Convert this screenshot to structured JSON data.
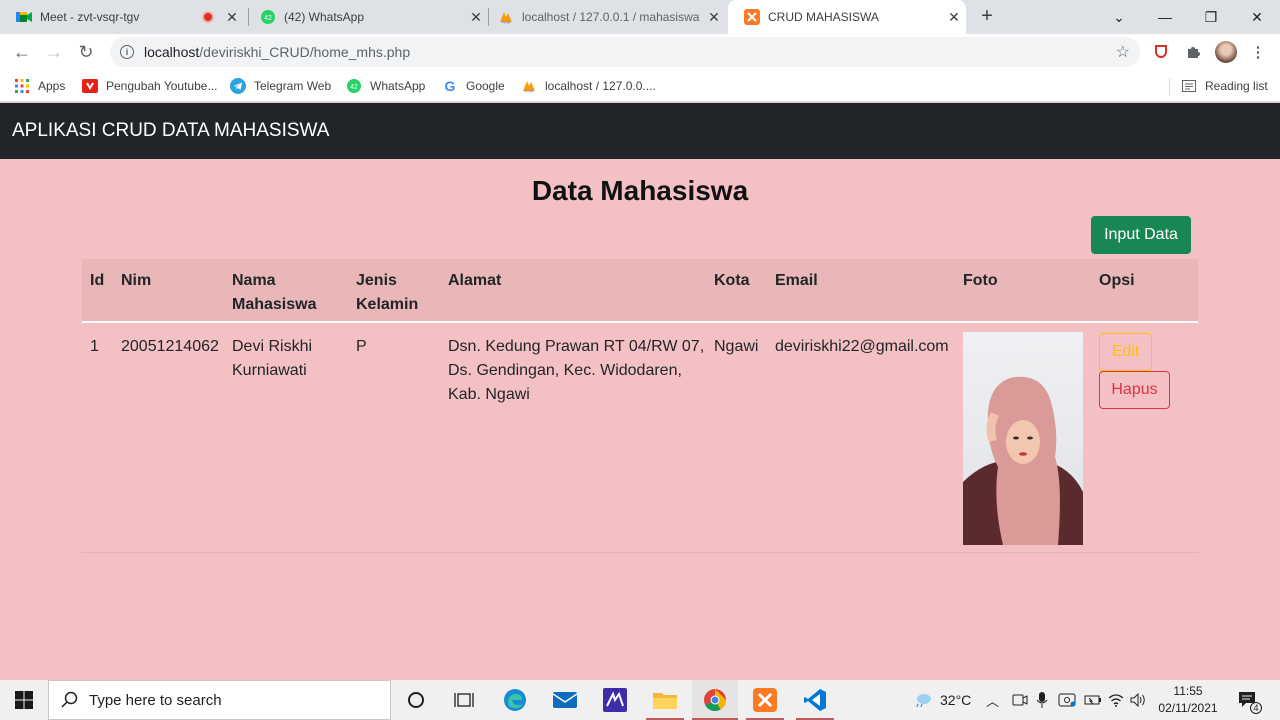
{
  "browser": {
    "tabs": [
      {
        "title": "Meet - zvt-vsqr-tgv",
        "icon": "google-meet-icon"
      },
      {
        "title": "(42) WhatsApp",
        "icon": "whatsapp-icon"
      },
      {
        "title": "localhost / 127.0.0.1 / mahasiswa",
        "icon": "phpmyadmin-icon"
      },
      {
        "title": "CRUD MAHASISWA",
        "icon": "xampp-icon"
      }
    ],
    "url_host": "localhost",
    "url_path": "/deviriskhi_CRUD/home_mhs.php",
    "bookmarks": [
      "Apps",
      "Pengubah Youtube...",
      "Telegram Web",
      "WhatsApp",
      "Google",
      "localhost / 127.0.0...."
    ],
    "reading_list": "Reading list",
    "whatsapp_badge": "42"
  },
  "app": {
    "brand": "APLIKASI CRUD DATA MAHASISWA",
    "page_title": "Data Mahasiswa",
    "input_button": "Input Data",
    "table": {
      "headers": {
        "id": "Id",
        "nim": "Nim",
        "nama_1": "Nama",
        "nama_2": "Mahasiswa",
        "jk_1": "Jenis",
        "jk_2": "Kelamin",
        "alamat": "Alamat",
        "kota": "Kota",
        "email": "Email",
        "foto": "Foto",
        "opsi": "Opsi"
      },
      "rows": [
        {
          "id": "1",
          "nim": "20051214062",
          "nama_1": "Devi Riskhi",
          "nama_2": "Kurniawati",
          "jk": "P",
          "alamat_1": "Dsn. Kedung Prawan RT 04/RW 07,",
          "alamat_2": "Ds. Gendingan, Kec. Widodaren,",
          "alamat_3": "Kab. Ngawi",
          "kota": "Ngawi",
          "email": "deviriskhi22@gmail.com",
          "edit": "Edit",
          "hapus": "Hapus"
        }
      ]
    }
  },
  "taskbar": {
    "search_placeholder": "Type here to search",
    "weather": "32°C",
    "time": "11:55",
    "date": "02/11/2021",
    "notif_count": "4"
  },
  "colors": {
    "page_bg": "#f3c1c3",
    "navbar": "#212529",
    "success": "#198754",
    "warning": "#ffc107",
    "danger": "#dc3545"
  }
}
